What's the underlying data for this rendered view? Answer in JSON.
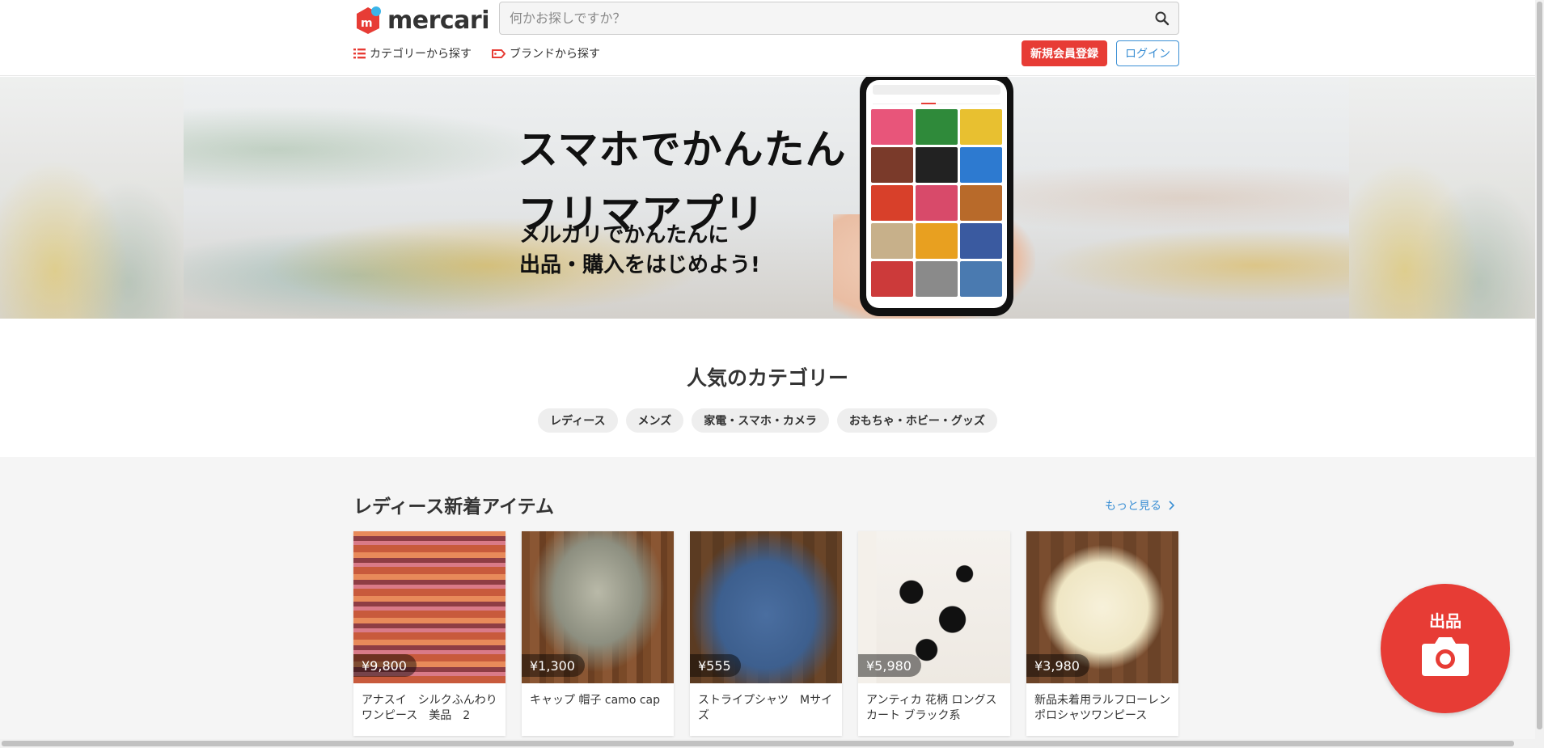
{
  "header": {
    "logo_text": "mercari",
    "search_placeholder": "何かお探しですか？",
    "nav": {
      "category_label": "カテゴリーから探す",
      "brand_label": "ブランドから探す"
    },
    "signup_label": "新規会員登録",
    "login_label": "ログイン"
  },
  "hero": {
    "title": "スマホでかんたん\nフリマアプリ",
    "subtitle": "メルカリでかんたんに\n出品・購入をはじめよう!"
  },
  "popular": {
    "title": "人気のカテゴリー",
    "chips": [
      "レディース",
      "メンズ",
      "家電・スマホ・カメラ",
      "おもちゃ・ホビー・グッズ"
    ]
  },
  "new_items": {
    "title": "レディース新着アイテム",
    "more_label": "もっと見る",
    "items": [
      {
        "price": "¥9,800",
        "name": "アナスイ　シルクふんわりワンピース　美品　2"
      },
      {
        "price": "¥1,300",
        "name": "キャップ 帽子 camo cap"
      },
      {
        "price": "¥555",
        "name": "ストライプシャツ　Mサイズ"
      },
      {
        "price": "¥5,980",
        "name": "アンティカ 花柄 ロングスカート ブラック系"
      },
      {
        "price": "¥3,980",
        "name": "新品未着用ラルフローレン ポロシャツワンピース"
      }
    ]
  },
  "sell_button": {
    "label": "出品"
  },
  "colors": {
    "brand_red": "#e73c35",
    "link_blue": "#3b8fd4",
    "section_bg": "#f5f5f5",
    "chip_bg": "#eeeeee"
  },
  "icons": [
    "mercari-logo-icon",
    "search-icon",
    "list-icon",
    "tag-icon",
    "chevron-right-icon",
    "camera-icon"
  ]
}
